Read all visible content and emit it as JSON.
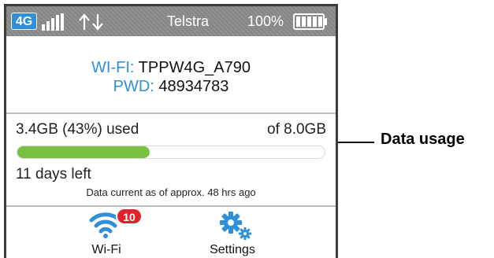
{
  "status_bar": {
    "network_badge": "4G",
    "signal_icon": "signal-bars-icon",
    "transfer_icon": "up-down-arrows-icon",
    "carrier": "Telstra",
    "battery_percent": "100%",
    "battery_icon": "battery-full-icon",
    "battery_level": 1.0,
    "colors": {
      "bar": "#8a8a8a",
      "badge": "#2f8fd8"
    }
  },
  "wifi_info": {
    "ssid_label": "WI-FI:",
    "ssid_value": "TPPW4G_A790",
    "password_label": "PWD:",
    "password_value": "48934783"
  },
  "usage": {
    "used_text": "3.4GB (43%) used",
    "total_text": "of 8.0GB",
    "progress_fraction": 0.43,
    "days_left": "11 days left",
    "note": "Data current as of approx. 48 hrs ago",
    "fill_color": "#7ac043"
  },
  "nav": {
    "wifi": {
      "label": "Wi-Fi",
      "icon": "wifi-icon",
      "badge_count": "10"
    },
    "settings": {
      "label": "Settings",
      "icon": "gear-icon"
    }
  },
  "callout": {
    "label": "Data usage"
  },
  "accent_color": "#2f8fd8",
  "alert_color": "#e3212b"
}
